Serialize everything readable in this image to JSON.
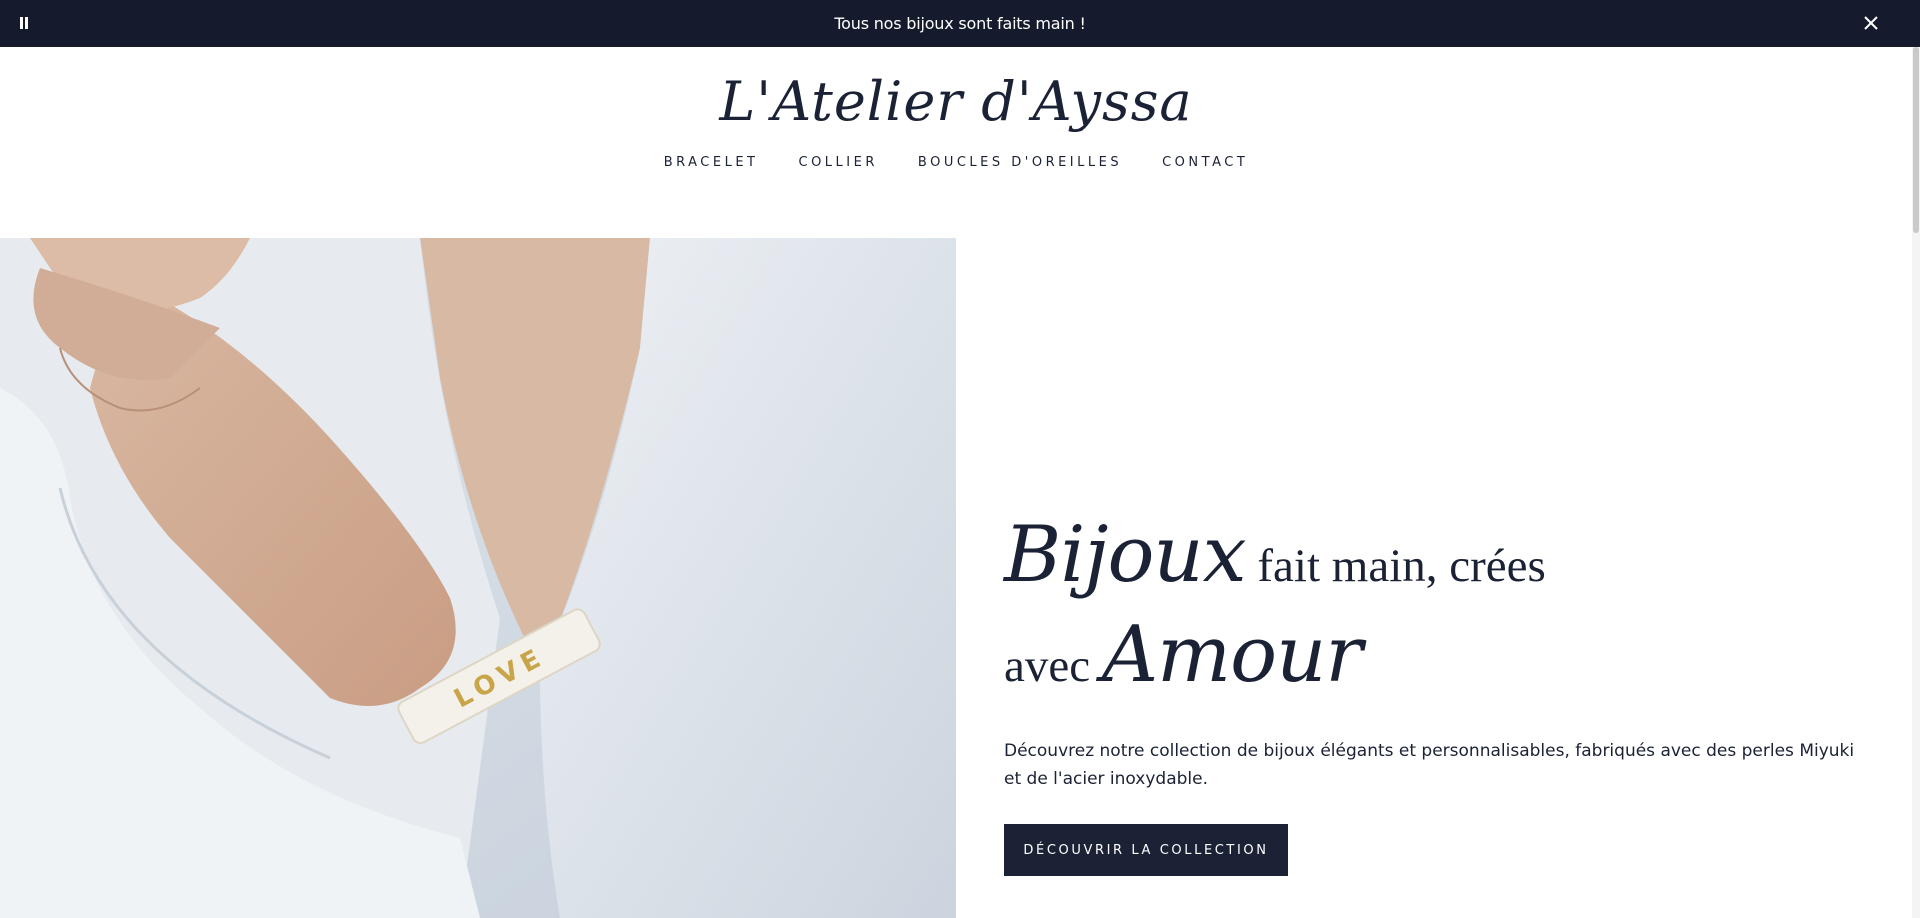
{
  "announcement": {
    "text": "Tous nos bijoux sont faits main !",
    "pause_icon": "pause-icon",
    "close_icon": "close-icon"
  },
  "header": {
    "logo": "L'Atelier d'Ayssa",
    "nav": [
      {
        "label": "BRACELET"
      },
      {
        "label": "COLLIER"
      },
      {
        "label": "BOUCLES D'OREILLES"
      },
      {
        "label": "CONTACT"
      }
    ]
  },
  "hero": {
    "image_alt": "Woman in white blouse wearing a beaded LOVE bracelet",
    "headline": {
      "word1": "Bijoux",
      "rest1": " fait main, crées",
      "word2_prefix": "avec ",
      "word2": "Amour"
    },
    "description": "Découvrez notre collection de bijoux élégants et personnalisables, fabriqués avec des perles Miyuki et de l'acier inoxydable.",
    "cta_label": "DÉCOUVRIR LA COLLECTION"
  },
  "colors": {
    "navy": "#1b2235",
    "announcement_bg": "#151b2c",
    "background": "#ffffff"
  }
}
